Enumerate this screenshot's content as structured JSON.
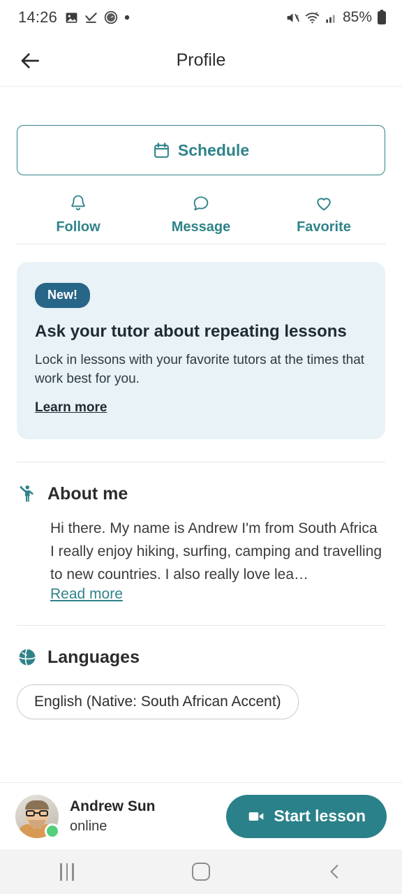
{
  "status_bar": {
    "time": "14:26",
    "left_icons": [
      "image-icon",
      "download-complete-icon",
      "screen-record-icon",
      "dot-icon"
    ],
    "right_icons": [
      "mute-icon",
      "wifi-6-icon",
      "cellular-signal-icon",
      "battery-icon"
    ],
    "battery_percent": "85%"
  },
  "header": {
    "back_icon": "arrow-left-icon",
    "title": "Profile"
  },
  "schedule": {
    "icon": "calendar-icon",
    "label": "Schedule"
  },
  "actions": [
    {
      "icon": "bell-icon",
      "label": "Follow"
    },
    {
      "icon": "chat-bubble-icon",
      "label": "Message"
    },
    {
      "icon": "heart-icon",
      "label": "Favorite"
    }
  ],
  "promo": {
    "badge": "New!",
    "title": "Ask your tutor about repeating lessons",
    "body": "Lock in lessons with your favorite tutors at the times that work best for you.",
    "link": "Learn more"
  },
  "about": {
    "icon": "waving-person-icon",
    "title": "About me",
    "text": "Hi there. My name is Andrew I'm from South Africa I really enjoy hiking, surfing, camping and travelling to new countries. I also really love lea…",
    "read_more": "Read more"
  },
  "languages": {
    "icon": "globe-icon",
    "title": "Languages",
    "chips": [
      "English (Native: South African Accent)"
    ]
  },
  "bottom_bar": {
    "avatar": "tutor-avatar",
    "status_dot": "online-indicator",
    "name": "Andrew Sun",
    "status": "online",
    "cta_icon": "video-camera-icon",
    "cta_label": "Start lesson"
  },
  "nav_bar": {
    "recents": "recents-icon",
    "home": "home-icon",
    "back": "back-icon"
  },
  "colors": {
    "teal": "#2f8389",
    "teal_solid": "#2b8189",
    "badge_blue": "#286688",
    "promo_bg": "#e9f2f6",
    "online_green": "#54d07c"
  }
}
